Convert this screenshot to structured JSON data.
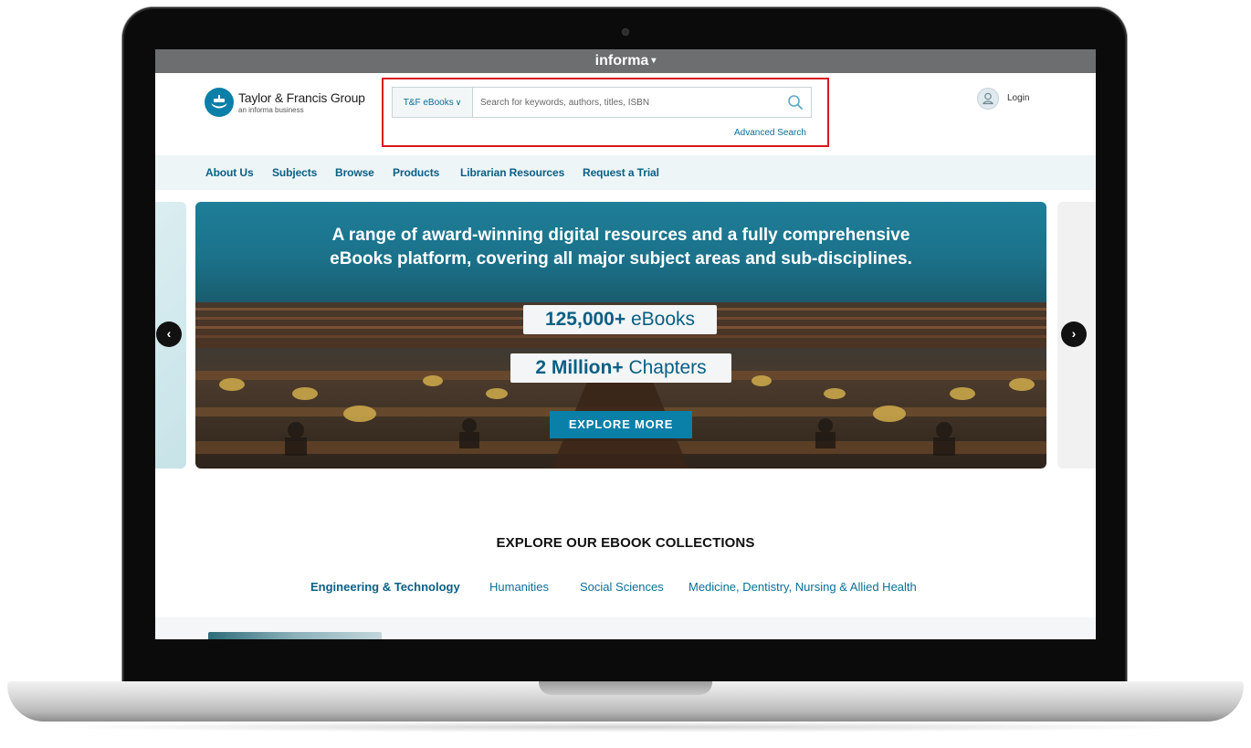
{
  "topbar": {
    "brand": "informa",
    "caret": "▾"
  },
  "header": {
    "logo_name": "Taylor & Francis Group",
    "logo_subtitle": "an informa business",
    "search": {
      "scope_label": "T&F eBooks",
      "scope_chevron": "∨",
      "placeholder": "Search for keywords, authors, titles, ISBN",
      "advanced_label": "Advanced Search"
    },
    "login_label": "Login"
  },
  "nav": {
    "items": [
      {
        "label": "About Us"
      },
      {
        "label": "Subjects"
      },
      {
        "label": "Browse"
      },
      {
        "label": "Products"
      },
      {
        "label": "Librarian Resources"
      },
      {
        "label": "Request a Trial"
      }
    ]
  },
  "hero": {
    "headline_line1": "A range of award-winning digital resources and a fully comprehensive",
    "headline_line2": "eBooks platform, covering all major subject areas and sub-disciplines.",
    "stat1_value": "125,000+",
    "stat1_label": "eBooks",
    "stat2_value": "2 Million+",
    "stat2_label": "Chapters",
    "cta_label": "EXPLORE MORE",
    "prev_glyph": "‹",
    "next_glyph": "›"
  },
  "collections": {
    "title": "EXPLORE OUR EBOOK COLLECTIONS",
    "tabs": [
      {
        "label": "Engineering & Technology",
        "active": true
      },
      {
        "label": "Humanities",
        "active": false
      },
      {
        "label": "Social Sciences",
        "active": false
      },
      {
        "label": "Medicine, Dentistry, Nursing & Allied Health",
        "active": false
      }
    ]
  },
  "colors": {
    "brand_teal": "#0a7fa8",
    "nav_text": "#0a5f84",
    "highlight_red": "#d9171e",
    "informa_bar": "#6c6e70"
  },
  "icons": {
    "search": "search-icon",
    "user": "user-icon",
    "prev": "chevron-left-icon",
    "next": "chevron-right-icon",
    "logo": "taylor-francis-logo-icon"
  }
}
